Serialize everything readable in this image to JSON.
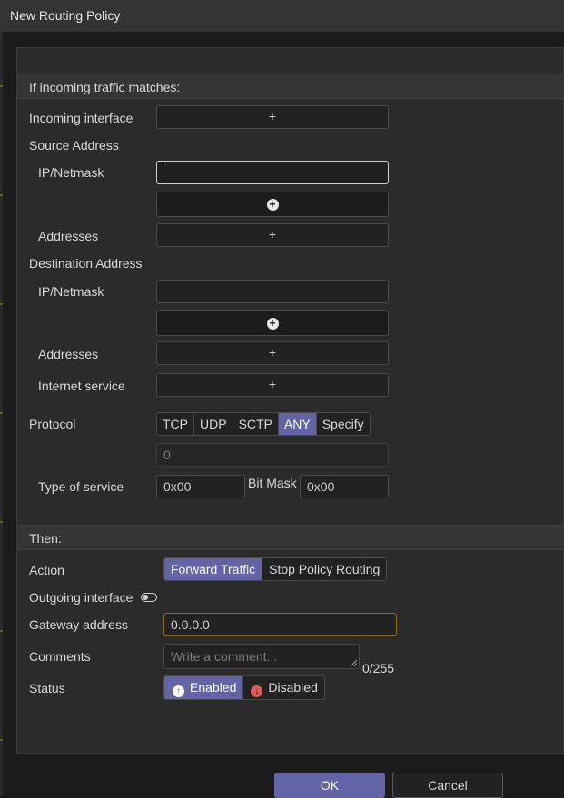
{
  "window": {
    "title": "New Routing Policy"
  },
  "match_section": {
    "header": "If incoming traffic matches:",
    "incoming_interface": {
      "label": "Incoming interface",
      "button": "+"
    },
    "source_address": {
      "label": "Source Address",
      "ip_netmask_label": "IP/Netmask",
      "ip_netmask_value": "",
      "add_button": "+",
      "addresses_label": "Addresses",
      "addresses_button": "+"
    },
    "destination_address": {
      "label": "Destination Address",
      "ip_netmask_label": "IP/Netmask",
      "ip_netmask_value": "",
      "add_button": "+",
      "addresses_label": "Addresses",
      "addresses_button": "+",
      "internet_service_label": "Internet service",
      "internet_service_button": "+"
    },
    "protocol": {
      "label": "Protocol",
      "options": [
        "TCP",
        "UDP",
        "SCTP",
        "ANY",
        "Specify"
      ],
      "selected": "ANY",
      "number_value": "0"
    },
    "type_of_service": {
      "label": "Type of service",
      "value": "0x00",
      "bit_mask_label": "Bit Mask",
      "bit_mask_value": "0x00"
    }
  },
  "then_section": {
    "header": "Then:",
    "action": {
      "label": "Action",
      "options": [
        "Forward Traffic",
        "Stop Policy Routing"
      ],
      "selected": "Forward Traffic"
    },
    "outgoing_interface": {
      "label": "Outgoing interface",
      "enabled": false
    },
    "gateway_address": {
      "label": "Gateway address",
      "value": "0.0.0.0"
    },
    "comments": {
      "label": "Comments",
      "placeholder": "Write a comment...",
      "counter": "0/255"
    },
    "status": {
      "label": "Status",
      "options": [
        "Enabled",
        "Disabled"
      ],
      "selected": "Enabled"
    }
  },
  "footer": {
    "ok_label": "OK",
    "cancel_label": "Cancel"
  },
  "colors": {
    "accent": "#6264a7",
    "enabled_icon": "#ffffff",
    "disabled_icon": "#e05a5a",
    "gateway_border": "#8a6b1f"
  },
  "icons": {
    "add": "plus-icon",
    "add_circle": "plus-circle-icon",
    "enabled": "arrow-up-circle-icon",
    "disabled": "arrow-down-circle-icon"
  }
}
